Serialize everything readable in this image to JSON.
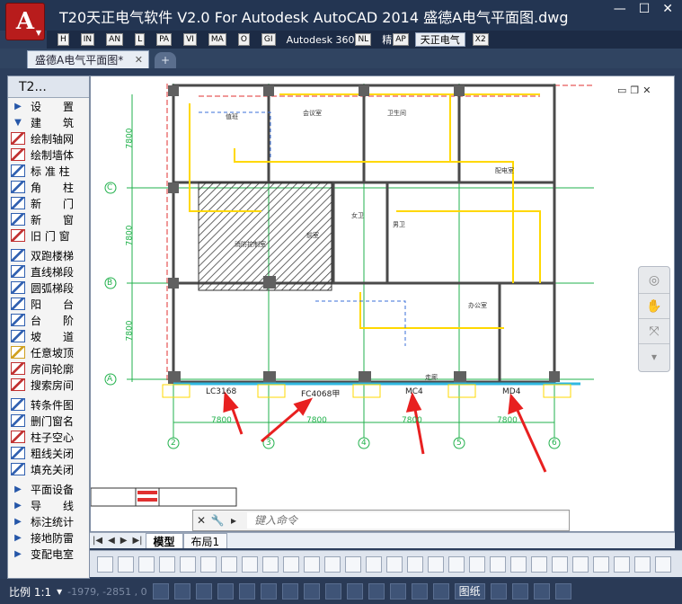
{
  "title_bar": {
    "logo": "A",
    "title": "T20天正电气软件 V2.0 For Autodesk AutoCAD 2014    盛德A电气平面图.dwg"
  },
  "ribbon_tabs": [
    {
      "label": "",
      "key": "H"
    },
    {
      "label": "",
      "key": "IN"
    },
    {
      "label": "",
      "key": "AN"
    },
    {
      "label": "",
      "key": "L"
    },
    {
      "label": "",
      "key": "PA"
    },
    {
      "label": "",
      "key": "VI"
    },
    {
      "label": "",
      "key": "MA"
    },
    {
      "label": "",
      "key": "O"
    },
    {
      "label": "",
      "key": "GI"
    },
    {
      "label": "Autodesk 360",
      "key": "NL"
    },
    {
      "label": "精",
      "key": "AP"
    },
    {
      "label": "天正电气",
      "key": ""
    },
    {
      "label": "",
      "key": "X2"
    }
  ],
  "document_tab": "盛德A电气平面图*",
  "palette": {
    "header": "T2...",
    "items": [
      {
        "label": "设　　置",
        "kind": "arrow",
        "icon": "triangle-right-icon"
      },
      {
        "label": "建　　筑",
        "kind": "arrow",
        "icon": "triangle-down-icon"
      },
      {
        "label": "绘制轴网",
        "kind": "icon",
        "icon": "axis-grid-icon",
        "color": "#c03030"
      },
      {
        "label": "绘制墙体",
        "kind": "icon",
        "icon": "wall-icon",
        "color": "#c03030"
      },
      {
        "label": "标 准 柱",
        "kind": "icon",
        "icon": "column-icon",
        "color": "#3060b0"
      },
      {
        "label": "角　　柱",
        "kind": "icon",
        "icon": "corner-column-icon",
        "color": "#3060b0"
      },
      {
        "label": "新　　门",
        "kind": "icon",
        "icon": "door-icon",
        "color": "#3060b0"
      },
      {
        "label": "新　　窗",
        "kind": "icon",
        "icon": "window-icon",
        "color": "#3060b0"
      },
      {
        "label": "旧 门 窗",
        "kind": "icon",
        "icon": "old-door-window-icon",
        "color": "#c03030"
      },
      {
        "label": "",
        "kind": "sep"
      },
      {
        "label": "双跑楼梯",
        "kind": "icon",
        "icon": "double-stair-icon",
        "color": "#3060b0"
      },
      {
        "label": "直线梯段",
        "kind": "icon",
        "icon": "straight-stair-icon",
        "color": "#3060b0"
      },
      {
        "label": "圆弧梯段",
        "kind": "icon",
        "icon": "arc-stair-icon",
        "color": "#3060b0"
      },
      {
        "label": "阳　　台",
        "kind": "icon",
        "icon": "balcony-icon",
        "color": "#3060b0"
      },
      {
        "label": "台　　阶",
        "kind": "icon",
        "icon": "step-icon",
        "color": "#3060b0"
      },
      {
        "label": "坡　　道",
        "kind": "icon",
        "icon": "ramp-icon",
        "color": "#3060b0"
      },
      {
        "label": "任意坡顶",
        "kind": "icon",
        "icon": "roof-icon",
        "color": "#d0a020"
      },
      {
        "label": "房间轮廓",
        "kind": "icon",
        "icon": "room-outline-icon",
        "color": "#c03030"
      },
      {
        "label": "搜索房间",
        "kind": "icon",
        "icon": "search-room-icon",
        "color": "#c03030"
      },
      {
        "label": "",
        "kind": "sep"
      },
      {
        "label": "转条件图",
        "kind": "icon",
        "icon": "convert-icon",
        "color": "#3060b0"
      },
      {
        "label": "删门窗名",
        "kind": "icon",
        "icon": "delete-name-icon",
        "color": "#3060b0"
      },
      {
        "label": "柱子空心",
        "kind": "icon",
        "icon": "hollow-column-icon",
        "color": "#c03030"
      },
      {
        "label": "粗线关闭",
        "kind": "icon",
        "icon": "bulb-icon",
        "color": "#3060b0"
      },
      {
        "label": "填充关闭",
        "kind": "icon",
        "icon": "bulb-icon",
        "color": "#3060b0"
      },
      {
        "label": "",
        "kind": "sep"
      },
      {
        "label": "平面设备",
        "kind": "arrow",
        "icon": "triangle-right-icon"
      },
      {
        "label": "导　　线",
        "kind": "arrow",
        "icon": "triangle-right-icon"
      },
      {
        "label": "标注统计",
        "kind": "arrow",
        "icon": "triangle-right-icon"
      },
      {
        "label": "接地防雷",
        "kind": "arrow",
        "icon": "triangle-right-icon"
      },
      {
        "label": "变配电室",
        "kind": "arrow",
        "icon": "triangle-right-icon"
      }
    ]
  },
  "drawing": {
    "axis_labels_left": [
      "C",
      "B",
      "A"
    ],
    "axis_labels_bottom": [
      "2",
      "3",
      "4",
      "5",
      "6"
    ],
    "dimensions_left": [
      "7800",
      "7800",
      "7800"
    ],
    "dimensions_bottom": [
      "7800",
      "7800",
      "7800",
      "7800"
    ],
    "door_labels": [
      "LC3168",
      "FC4068甲",
      "MC4",
      "MD4"
    ],
    "room_labels": [
      "会议室",
      "值班",
      "卫生间",
      "消防控制室",
      "配电室",
      "女卫",
      "男卫",
      "前室",
      "走廊",
      "办公室"
    ]
  },
  "command": {
    "placeholder": "键入命令"
  },
  "layout_tabs": [
    "模型",
    "布局1"
  ],
  "status": {
    "scale": "比例 1:1",
    "coords": "-1979,  -2851 , 0",
    "label": "图纸"
  }
}
